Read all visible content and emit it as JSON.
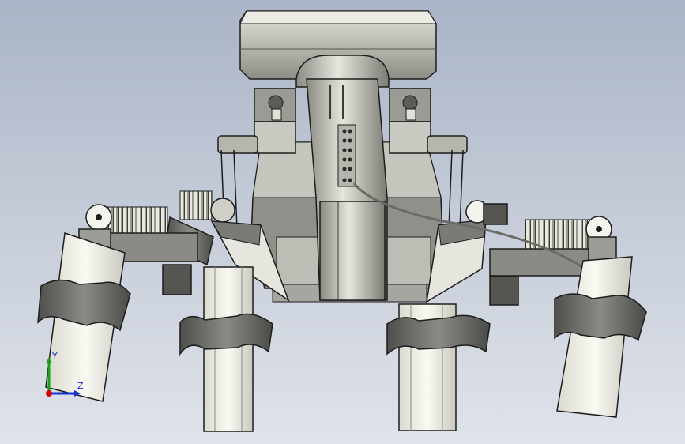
{
  "viewport": {
    "background_top": "#aab4c6",
    "background_bottom": "#dfe3ea"
  },
  "model": {
    "metal_light": "#dcdcd2",
    "metal_mid": "#a9a9a1",
    "metal_dark": "#5f605c",
    "foot_color": "#f1f1e8",
    "outline": "#1c1c1c"
  },
  "triad": {
    "y_label": "Y",
    "z_label": "Z",
    "x_color": "#d40000",
    "y_color": "#16a116",
    "z_color": "#1733d6"
  }
}
